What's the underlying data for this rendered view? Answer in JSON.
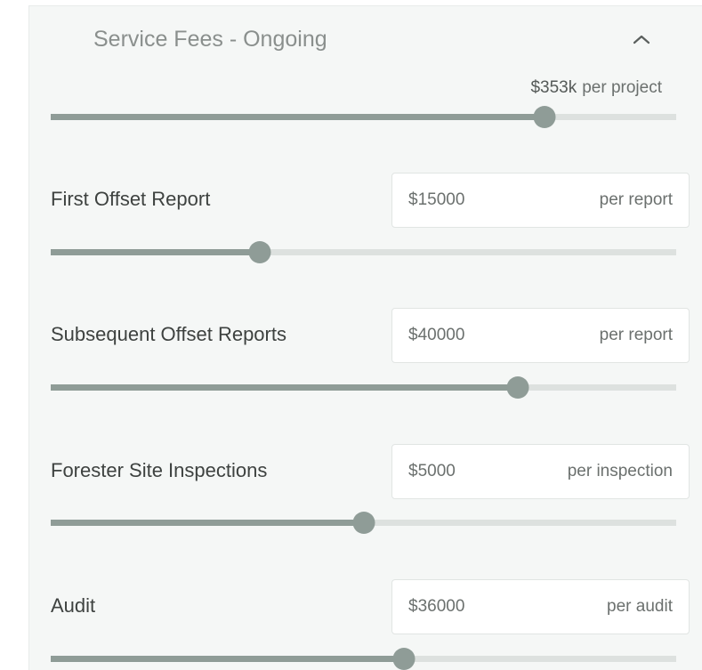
{
  "section": {
    "title": "Service Fees - Ongoing",
    "expanded": true,
    "total_value": "$353k",
    "total_unit": "per project",
    "total_slider_fraction": 0.79
  },
  "fields": [
    {
      "label": "First Offset Report",
      "value": "$15000",
      "unit": "per report",
      "slider_fraction": 0.334
    },
    {
      "label": "Subsequent Offset Reports",
      "value": "$40000",
      "unit": "per report",
      "slider_fraction": 0.747
    },
    {
      "label": "Forester Site Inspections",
      "value": "$5000",
      "unit": "per inspection",
      "slider_fraction": 0.5
    },
    {
      "label": "Audit",
      "value": "$36000",
      "unit": "per audit",
      "slider_fraction": 0.565
    }
  ],
  "colors": {
    "slider_fill": "#8f9c97",
    "slider_track": "#dde1df",
    "panel_bg": "#f5f7f6"
  },
  "icons": {
    "collapse": "chevron-up-icon"
  }
}
